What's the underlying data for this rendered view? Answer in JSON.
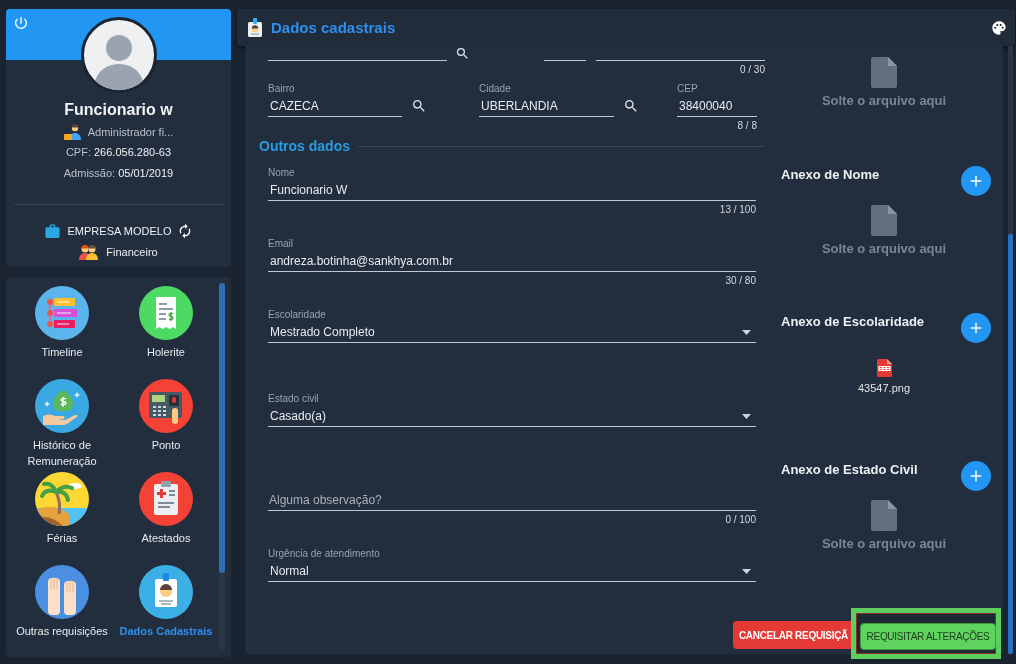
{
  "profile": {
    "name": "Funcionario w",
    "role": "Administrador fi...",
    "cpf_label": "CPF:",
    "cpf": "266.056.280-63",
    "admission_label": "Admissão:",
    "admission": "05/01/2019",
    "company": "EMPRESA MODELO",
    "department": "Financeiro"
  },
  "menu": [
    {
      "label": "Timeline",
      "selected": false
    },
    {
      "label": "Holerite",
      "selected": false
    },
    {
      "label": "Histórico de Remuneração",
      "selected": false
    },
    {
      "label": "Ponto",
      "selected": false
    },
    {
      "label": "Férias",
      "selected": false
    },
    {
      "label": "Atestados",
      "selected": false
    },
    {
      "label": "Outras requisições",
      "selected": false
    },
    {
      "label": "Dados Cadastrais",
      "selected": true
    }
  ],
  "header": {
    "title": "Dados cadastrais"
  },
  "form": {
    "top_row": {
      "counter": "0 / 30"
    },
    "address": [
      {
        "kind": "search",
        "label": "Bairro",
        "value": "CAZECA"
      },
      {
        "kind": "search",
        "label": "Cidade",
        "value": "UBERLANDIA"
      },
      {
        "kind": "text",
        "label": "CEP",
        "value": "38400040",
        "counter": "8 / 8"
      }
    ],
    "section_title": "Outros dados",
    "fields": [
      {
        "kind": "text",
        "label": "Nome",
        "value": "Funcionario W",
        "counter": "13 / 100"
      },
      {
        "kind": "text",
        "label": "Email",
        "value": "andreza.botinha@sankhya.com.br",
        "counter": "30 / 80"
      },
      {
        "kind": "select",
        "label": "Escolaridade",
        "value": "Mestrado Completo"
      },
      {
        "kind": "select",
        "label": "Estado civil",
        "value": "Casado(a)"
      },
      {
        "kind": "textarea",
        "placeholder": "Alguma observação?",
        "counter": "0 / 100"
      },
      {
        "kind": "select",
        "label": "Urgência de atendimento",
        "value": "Normal"
      }
    ]
  },
  "attachments": [
    {
      "kind": "empty",
      "drop_text": "Solte o arquivo aqui"
    },
    {
      "kind": "empty",
      "title": "Anexo de Nome",
      "drop_text": "Solte o arquivo aqui"
    },
    {
      "kind": "file",
      "title": "Anexo de Escolaridade",
      "file_name": "43547.png"
    },
    {
      "kind": "empty",
      "title": "Anexo de Estado Civil",
      "drop_text": "Solte o arquivo aqui"
    }
  ],
  "actions": [
    {
      "kind": "cancel",
      "label": "CANCELAR REQUISIÇÃ",
      "highlighted": false
    },
    {
      "kind": "submit",
      "label": "REQUISITAR ALTERAÇÕES",
      "highlighted": true
    }
  ]
}
